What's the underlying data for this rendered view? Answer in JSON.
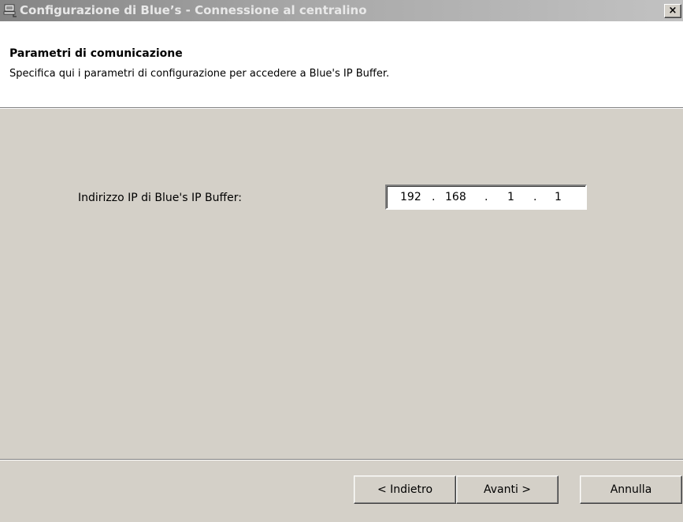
{
  "window": {
    "title": "Configurazione di Blue’s - Connessione al centralino",
    "close_glyph": "×"
  },
  "header": {
    "title": "Parametri di comunicazione",
    "subtitle": "Specifica qui i parametri di configurazione per accedere a Blue's IP Buffer."
  },
  "form": {
    "ip_label": "Indirizzo IP di Blue's IP Buffer:",
    "ip_octets": [
      "192",
      "168",
      "1",
      "1"
    ],
    "ip_separator": "."
  },
  "buttons": {
    "back": "< Indietro",
    "next": "Avanti >",
    "cancel": "Annulla"
  },
  "icons": {
    "title": "network-computer-icon",
    "close": "close-icon"
  }
}
